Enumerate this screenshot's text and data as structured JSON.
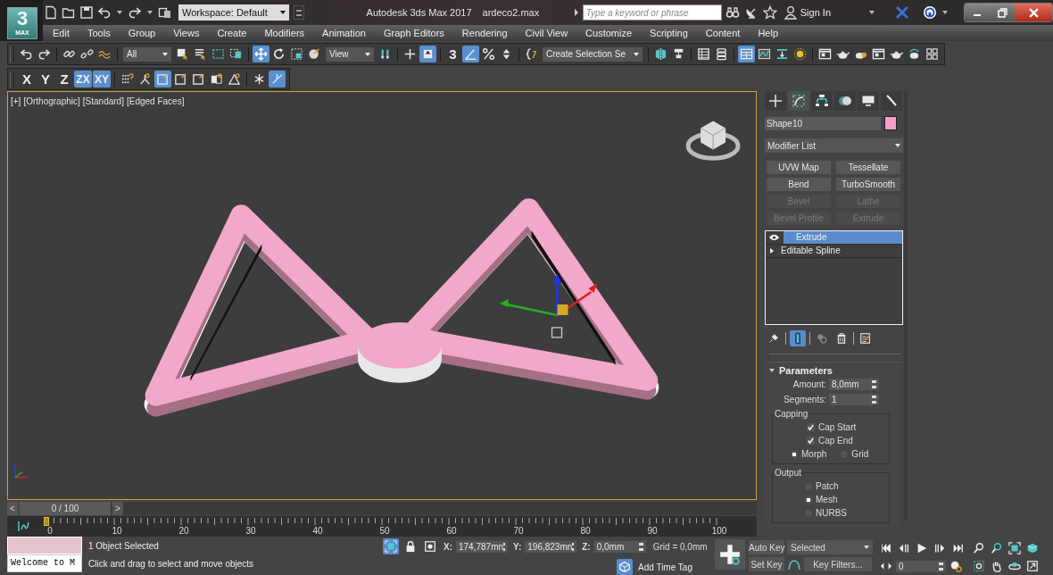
{
  "title_bar": {
    "logo": "3",
    "logo_sub": "MAX",
    "workspace": "Workspace: Default",
    "app_title": "Autodesk 3ds Max 2017",
    "file_name": "ardeco2.max",
    "search": {
      "placeholder": "Type a keyword or phrase"
    },
    "sign_in": "Sign In"
  },
  "menu": [
    "Edit",
    "Tools",
    "Group",
    "Views",
    "Create",
    "Modifiers",
    "Animation",
    "Graph Editors",
    "Rendering",
    "Civil View",
    "Customize",
    "Scripting",
    "Content",
    "Help"
  ],
  "main_toolbar": [
    {
      "kind": "icon",
      "selected": false
    },
    {
      "kind": "icon",
      "selected": false
    },
    {
      "kind": "separator"
    },
    {
      "kind": "icon",
      "selected": false
    },
    {
      "kind": "icon",
      "selected": false
    },
    {
      "kind": "icon",
      "selected": false
    },
    {
      "kind": "separator"
    },
    {
      "kind": "dropdown",
      "value": "All"
    },
    {
      "kind": "icon",
      "selected": false
    },
    {
      "kind": "icon",
      "selected": false
    },
    {
      "kind": "icon",
      "selected": false
    },
    {
      "kind": "icon",
      "selected": false
    },
    {
      "kind": "separator"
    },
    {
      "kind": "icon",
      "selected": true
    },
    {
      "kind": "icon",
      "selected": false
    },
    {
      "kind": "icon",
      "selected": false
    },
    {
      "kind": "icon",
      "selected": false
    },
    {
      "kind": "dropdown",
      "value": "View"
    },
    {
      "kind": "icon",
      "selected": false
    },
    {
      "kind": "separator"
    },
    {
      "kind": "icon",
      "selected": false
    },
    {
      "kind": "icon",
      "selected": true
    },
    {
      "kind": "separator"
    },
    {
      "kind": "text-icon",
      "label": "3",
      "selected": false
    },
    {
      "kind": "icon",
      "selected": true
    },
    {
      "kind": "icon",
      "selected": false
    },
    {
      "kind": "icon",
      "selected": false
    },
    {
      "kind": "separator"
    },
    {
      "kind": "icon",
      "selected": false
    },
    {
      "kind": "dropdown",
      "value": "Create Selection Se"
    },
    {
      "kind": "separator"
    },
    {
      "kind": "icon",
      "selected": false
    },
    {
      "kind": "icon",
      "selected": false
    },
    {
      "kind": "separator"
    },
    {
      "kind": "icon",
      "selected": false
    },
    {
      "kind": "icon",
      "selected": false
    },
    {
      "kind": "separator"
    },
    {
      "kind": "icon",
      "selected": true
    },
    {
      "kind": "icon",
      "selected": false
    },
    {
      "kind": "icon",
      "selected": false
    },
    {
      "kind": "icon",
      "selected": false
    },
    {
      "kind": "separator"
    },
    {
      "kind": "icon",
      "selected": false
    },
    {
      "kind": "icon",
      "selected": false
    },
    {
      "kind": "icon",
      "selected": false
    },
    {
      "kind": "icon",
      "selected": false
    },
    {
      "kind": "icon",
      "selected": false
    },
    {
      "kind": "icon",
      "selected": false
    },
    {
      "kind": "icon",
      "selected": false
    }
  ],
  "axis_toolbar": [
    {
      "kind": "text-button",
      "label": "X",
      "selected": false
    },
    {
      "kind": "text-button",
      "label": "Y",
      "selected": false
    },
    {
      "kind": "text-button",
      "label": "Z",
      "selected": false
    },
    {
      "kind": "text-button",
      "label": "ZX",
      "selected": true
    },
    {
      "kind": "text-button",
      "label": "XY",
      "selected": true
    },
    {
      "kind": "separator"
    },
    {
      "kind": "icon",
      "selected": false
    },
    {
      "kind": "icon",
      "selected": false
    },
    {
      "kind": "icon",
      "selected": true
    },
    {
      "kind": "icon",
      "selected": false
    },
    {
      "kind": "icon",
      "selected": false
    },
    {
      "kind": "icon",
      "selected": false
    },
    {
      "kind": "icon",
      "selected": false
    },
    {
      "kind": "separator"
    },
    {
      "kind": "icon",
      "selected": false
    },
    {
      "kind": "icon",
      "selected": true
    }
  ],
  "viewport": {
    "labels": [
      "[+]",
      "[Orthographic]",
      "[Standard]",
      "[Edged Faces]"
    ],
    "active": true
  },
  "command_panel": {
    "tabs": [
      {
        "selected": false
      },
      {
        "selected": true
      },
      {
        "selected": false
      },
      {
        "selected": false
      },
      {
        "selected": false
      },
      {
        "selected": false
      }
    ],
    "object_name": "Shape10",
    "modifier_list": "Modifier List",
    "modifier_buttons": [
      {
        "label": "UVW Map",
        "disabled": false
      },
      {
        "label": "Tessellate",
        "disabled": false
      },
      {
        "label": "Bend",
        "disabled": false
      },
      {
        "label": "TurboSmooth",
        "disabled": false
      },
      {
        "label": "Bevel",
        "disabled": true
      },
      {
        "label": "Lathe",
        "disabled": true
      },
      {
        "label": "Bevel Profile",
        "disabled": true
      },
      {
        "label": "Extrude",
        "disabled": true
      }
    ],
    "stack": [
      {
        "label": "Extrude",
        "selected": true,
        "expandable": false
      },
      {
        "label": "Editable Spline",
        "selected": false,
        "expandable": true
      }
    ],
    "stack_tools": [
      {
        "selected": false
      },
      {
        "selected": true
      },
      {
        "selected": false
      },
      {
        "selected": false
      },
      {
        "selected": false
      }
    ],
    "rollout": {
      "title": "Parameters",
      "expanded": true,
      "fields": [
        {
          "label": "Amount:",
          "value": "8,0mm"
        },
        {
          "label": "Segments:",
          "value": "1"
        }
      ],
      "groups": [
        {
          "title": "Capping",
          "checkboxes": [
            {
              "label": "Cap Start",
              "checked": true
            },
            {
              "label": "Cap End",
              "checked": true
            }
          ],
          "radios": [
            {
              "label": "Morph",
              "selected": true
            },
            {
              "label": "Grid",
              "selected": false
            }
          ]
        },
        {
          "title": "Output",
          "radios": [
            {
              "label": "Patch",
              "selected": false
            },
            {
              "label": "Mesh",
              "selected": true
            },
            {
              "label": "NURBS",
              "selected": false
            }
          ]
        }
      ]
    }
  },
  "time_slider": {
    "prev": "<",
    "next": ">",
    "label": "0 / 100",
    "level": 0
  },
  "track_bar": {
    "ticks": [
      "0",
      "10",
      "20",
      "30",
      "40",
      "50",
      "60",
      "70",
      "80",
      "90",
      "100"
    ]
  },
  "status": {
    "listener": "Welcome to M",
    "selection": "1 Object Selected",
    "hint": "Click and drag to select and move objects",
    "coords": [
      {
        "label": "X:",
        "value": "174,787mn"
      },
      {
        "label": "Y:",
        "value": "196,823mn"
      },
      {
        "label": "Z:",
        "value": "0,0mm"
      }
    ],
    "grid": "Grid = 0,0mm",
    "time_tag": "Add Time Tag"
  },
  "animation": {
    "auto_key": "Auto Key",
    "set_key": "Set Key",
    "key_mode": "Selected",
    "key_filters": "Key Filters...",
    "frame": "0"
  }
}
